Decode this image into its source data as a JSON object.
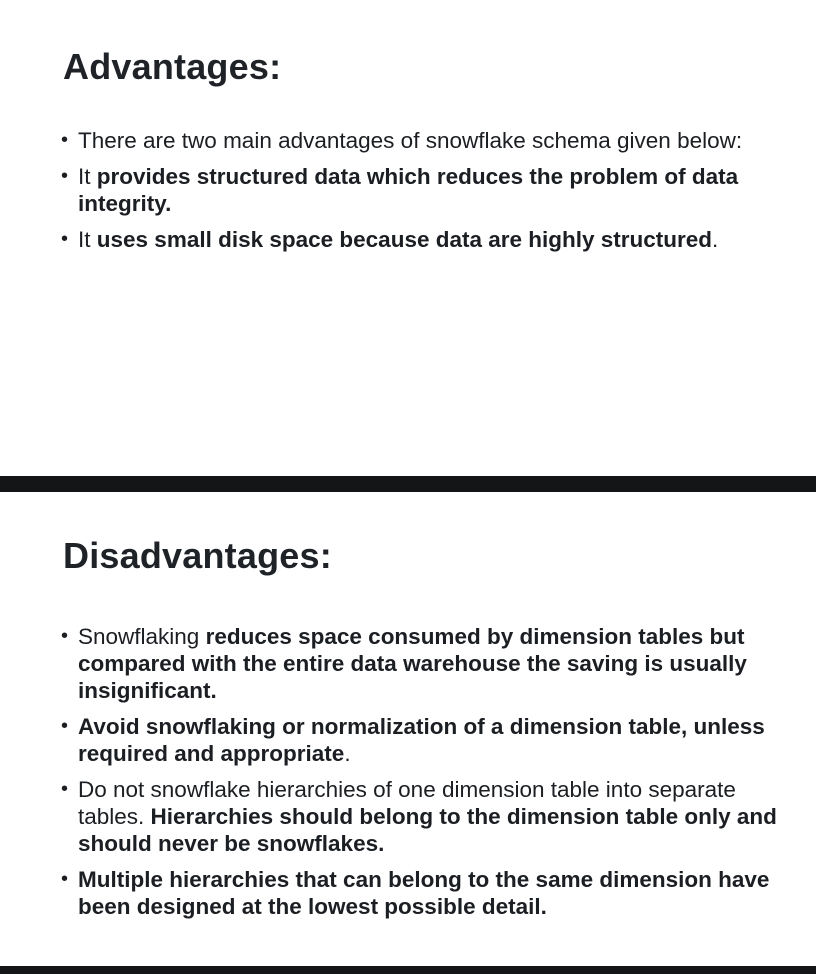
{
  "advantages": {
    "title": "Advantages:",
    "items": [
      {
        "normal": "There are two main advantages of snowflake schema given below:",
        "bold": ""
      },
      {
        "lead": "It ",
        "bold": "provides structured data which reduces the problem of data integrity."
      },
      {
        "lead": "It ",
        "bold": "uses small disk space because data are highly structured",
        "tail": "."
      }
    ]
  },
  "disadvantages": {
    "title": "Disadvantages:",
    "items": [
      {
        "lead": "Snowflaking ",
        "bold": "reduces space consumed by dimension tables but compared with the entire data warehouse the saving is usually insignificant."
      },
      {
        "bold": "Avoid snowflaking or normalization of a dimension table, unless required and appropriate",
        "tail": "."
      },
      {
        "lead": "Do not snowflake hierarchies of one dimension table into separate tables. ",
        "bold": "Hierarchies should belong to the dimension table only and should never be snowflakes."
      },
      {
        "bold": "Multiple hierarchies that can belong to the same dimension have been designed at the lowest possible detail."
      }
    ]
  },
  "bullet_glyph": "•"
}
